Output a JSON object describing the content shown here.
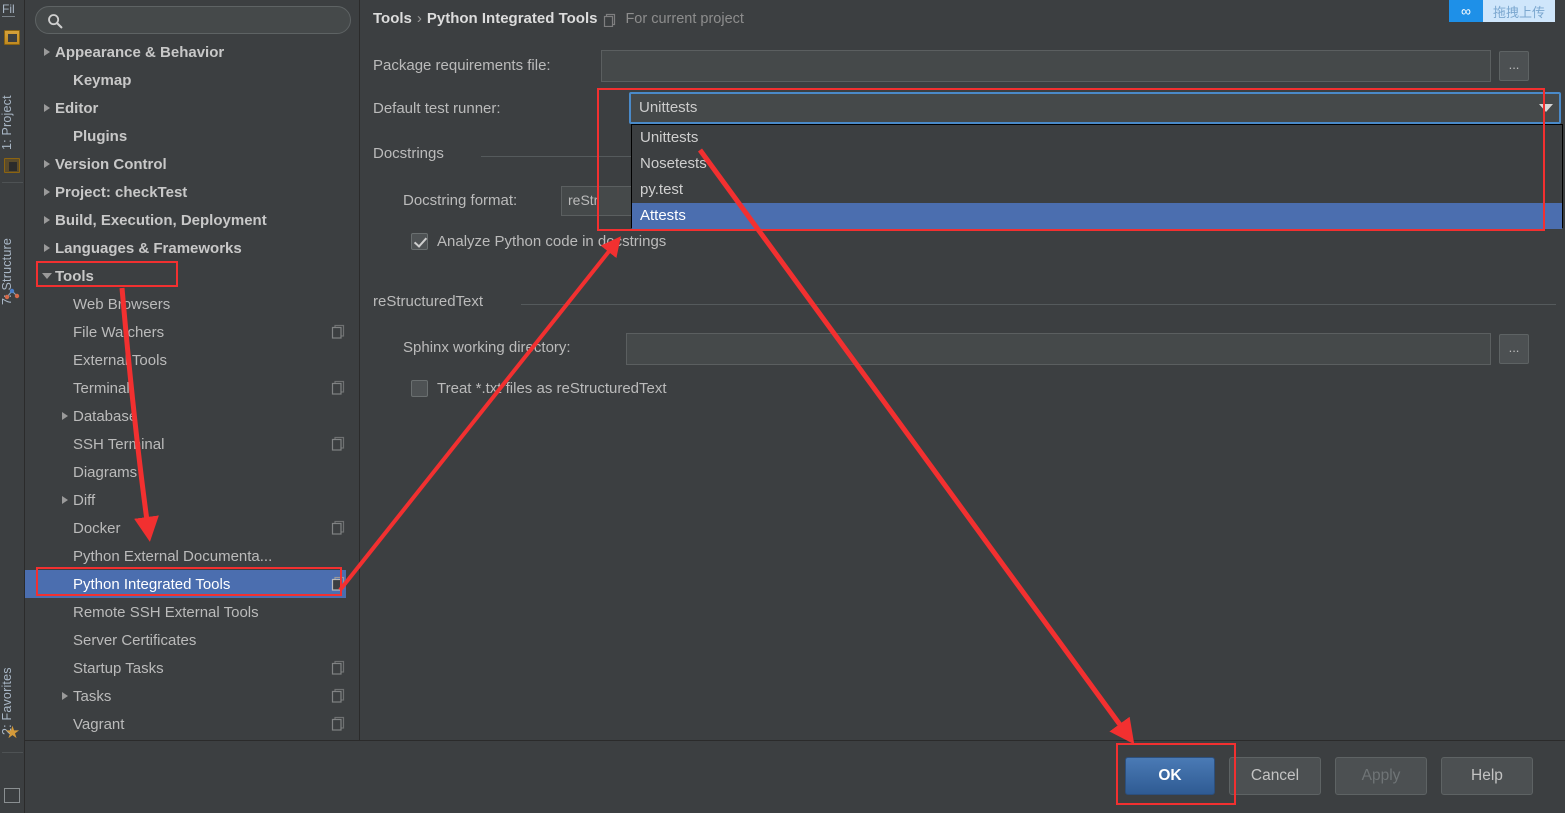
{
  "tool_strip": {
    "top_label": "Fil",
    "items": [
      {
        "label": "1: Project",
        "icon": "project-icon"
      },
      {
        "label": "7: Structure",
        "icon": "structure-icon"
      },
      {
        "label": "2: Favorites",
        "icon": "star-icon"
      }
    ]
  },
  "search": {
    "value": "",
    "placeholder": "",
    "icon": "search-icon"
  },
  "tree": [
    {
      "label": "Appearance & Behavior",
      "twisty": "collapsed",
      "bold": true,
      "indent": 0,
      "selected": false,
      "scope_icon": false
    },
    {
      "label": "Keymap",
      "twisty": "none",
      "bold": true,
      "indent": 1,
      "selected": false,
      "scope_icon": false
    },
    {
      "label": "Editor",
      "twisty": "collapsed",
      "bold": true,
      "indent": 0,
      "selected": false,
      "scope_icon": false
    },
    {
      "label": "Plugins",
      "twisty": "none",
      "bold": true,
      "indent": 1,
      "selected": false,
      "scope_icon": false
    },
    {
      "label": "Version Control",
      "twisty": "collapsed",
      "bold": true,
      "indent": 0,
      "selected": false,
      "scope_icon": false
    },
    {
      "label": "Project: checkTest",
      "twisty": "collapsed",
      "bold": true,
      "indent": 0,
      "selected": false,
      "scope_icon": false
    },
    {
      "label": "Build, Execution, Deployment",
      "twisty": "collapsed",
      "bold": true,
      "indent": 0,
      "selected": false,
      "scope_icon": false
    },
    {
      "label": "Languages & Frameworks",
      "twisty": "collapsed",
      "bold": true,
      "indent": 0,
      "selected": false,
      "scope_icon": false
    },
    {
      "label": "Tools",
      "twisty": "expanded",
      "bold": true,
      "indent": 0,
      "selected": false,
      "scope_icon": false
    },
    {
      "label": "Web Browsers",
      "twisty": "none",
      "bold": false,
      "indent": 1,
      "selected": false,
      "scope_icon": false
    },
    {
      "label": "File Watchers",
      "twisty": "none",
      "bold": false,
      "indent": 1,
      "selected": false,
      "scope_icon": true
    },
    {
      "label": "External Tools",
      "twisty": "none",
      "bold": false,
      "indent": 1,
      "selected": false,
      "scope_icon": false
    },
    {
      "label": "Terminal",
      "twisty": "none",
      "bold": false,
      "indent": 1,
      "selected": false,
      "scope_icon": true
    },
    {
      "label": "Database",
      "twisty": "collapsed",
      "bold": false,
      "indent": 1,
      "selected": false,
      "scope_icon": false
    },
    {
      "label": "SSH Terminal",
      "twisty": "none",
      "bold": false,
      "indent": 1,
      "selected": false,
      "scope_icon": true
    },
    {
      "label": "Diagrams",
      "twisty": "none",
      "bold": false,
      "indent": 1,
      "selected": false,
      "scope_icon": false
    },
    {
      "label": "Diff",
      "twisty": "collapsed",
      "bold": false,
      "indent": 1,
      "selected": false,
      "scope_icon": false
    },
    {
      "label": "Docker",
      "twisty": "none",
      "bold": false,
      "indent": 1,
      "selected": false,
      "scope_icon": true
    },
    {
      "label": "Python External Documenta...",
      "twisty": "none",
      "bold": false,
      "indent": 1,
      "selected": false,
      "scope_icon": false
    },
    {
      "label": "Python Integrated Tools",
      "twisty": "none",
      "bold": false,
      "indent": 1,
      "selected": true,
      "scope_icon": true
    },
    {
      "label": "Remote SSH External Tools",
      "twisty": "none",
      "bold": false,
      "indent": 1,
      "selected": false,
      "scope_icon": false
    },
    {
      "label": "Server Certificates",
      "twisty": "none",
      "bold": false,
      "indent": 1,
      "selected": false,
      "scope_icon": false
    },
    {
      "label": "Startup Tasks",
      "twisty": "none",
      "bold": false,
      "indent": 1,
      "selected": false,
      "scope_icon": true
    },
    {
      "label": "Tasks",
      "twisty": "collapsed",
      "bold": false,
      "indent": 1,
      "selected": false,
      "scope_icon": true
    },
    {
      "label": "Vagrant",
      "twisty": "none",
      "bold": false,
      "indent": 1,
      "selected": false,
      "scope_icon": true
    }
  ],
  "breadcrumb": {
    "parent": "Tools",
    "separator": "›",
    "current": "Python Integrated Tools",
    "scope_note": "For current project",
    "scope_icon": "project-scope-icon"
  },
  "form": {
    "package_requirements_label": "Package requirements file:",
    "package_requirements_value": "",
    "browse_label": "...",
    "default_test_runner_label": "Default test runner:",
    "default_test_runner_value": "Unittests",
    "test_runner_options": [
      "Unittests",
      "Nosetests",
      "py.test",
      "Attests"
    ],
    "test_runner_highlighted": "Attests",
    "docstrings_section": "Docstrings",
    "docstring_format_label": "Docstring format:",
    "docstring_format_value": "reStr",
    "analyze_checkbox_label": "Analyze Python code in docstrings",
    "analyze_checkbox_checked": true,
    "restructuredtext_section": "reStructuredText",
    "sphinx_dir_label": "Sphinx working directory:",
    "sphinx_dir_value": "",
    "treat_txt_label": "Treat *.txt files as reStructuredText",
    "treat_txt_checked": false
  },
  "buttons": {
    "ok": "OK",
    "cancel": "Cancel",
    "apply": "Apply",
    "help": "Help"
  },
  "upload_badge": {
    "icon": "link-icon",
    "text": "拖拽上传"
  },
  "colors": {
    "background": "#3c3f41",
    "selection_blue": "#4b6eaf",
    "focus_blue": "#4a8ac9",
    "annotation_red": "#f23030",
    "text": "#bbbbbb",
    "badge_blue": "#1e90e8"
  }
}
